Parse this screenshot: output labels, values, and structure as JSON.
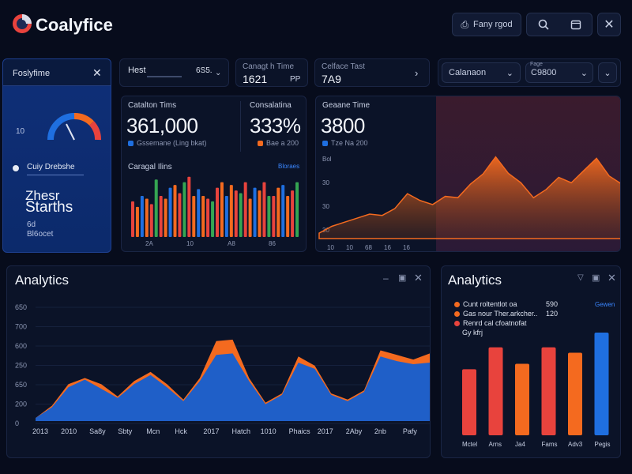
{
  "app": {
    "name": "Coalyfice"
  },
  "header": {
    "pill_label": "Fany rgod"
  },
  "side_card": {
    "title": "Foslyfime",
    "gauge_label": "10",
    "user_name": "Cuiy Drebshe",
    "big_text_1": "Zhesr",
    "big_text_2": "Starths",
    "foot_1": "6d",
    "foot_2": "Bl6ocet"
  },
  "stat_cards": [
    {
      "label": "Hest",
      "value": "6S5."
    },
    {
      "label": "Canagt h Time",
      "value": "1621",
      "suffix": "PP"
    },
    {
      "label": "Celface Tast",
      "value": "7A9"
    }
  ],
  "select": {
    "label": "Calanaon",
    "sub": "Fage",
    "value": "C9800"
  },
  "kpis": [
    {
      "title": "Catalton Tims",
      "value": "361,000",
      "legend": "Gssemane (Ling bkat)"
    },
    {
      "title": "Consalatina",
      "value": "333%",
      "legend": "Bae a 200"
    },
    {
      "title": "Geaane Time",
      "value": "3800",
      "legend": "Tze  Na 200"
    }
  ],
  "colors": {
    "orange": "#f46a1f",
    "blue": "#1f6fe0",
    "red": "#e8433d",
    "green": "#35a552",
    "panel": "#0b1328"
  },
  "small_bar_chart": {
    "title": "Caragal Ilins",
    "link": "Bloraes",
    "x_labels": [
      "2A",
      "10",
      "A8",
      "86"
    ]
  },
  "area_chart_small": {
    "x_labels": [
      "10",
      "10",
      "68",
      "16",
      "16"
    ],
    "y_labels": [
      "Bol",
      "30",
      "30",
      "30"
    ]
  },
  "analytics_main": {
    "title": "Analytics",
    "controls": [
      "minimize-icon",
      "restore-icon",
      "close-icon"
    ]
  },
  "analytics_side": {
    "title": "Analytics",
    "legend": [
      {
        "label": "Cunt roltentlot oa",
        "value": "590"
      },
      {
        "label": "Gas nour Ther.arkcher..",
        "value": "120"
      },
      {
        "label": "Renrd cal cfoatnofat",
        "value": ""
      }
    ],
    "legend_foot": "Gy kfrj",
    "link": "Gewen"
  },
  "chart_data": [
    {
      "type": "bar",
      "title": "Caragal Ilins",
      "categories": [
        "2A",
        "10",
        "A8",
        "86"
      ],
      "series": [
        {
          "values": [
            26,
            22,
            30,
            28,
            24,
            42,
            30,
            28,
            36,
            38,
            32,
            40,
            44,
            30,
            35,
            30,
            28,
            26,
            36,
            40,
            30,
            38,
            34,
            32,
            40,
            28,
            36,
            34,
            40,
            30,
            30,
            36,
            38,
            30,
            34,
            40
          ]
        }
      ]
    },
    {
      "type": "area",
      "x": [
        "10",
        "10",
        "68",
        "16",
        "16"
      ],
      "y_ticks": [
        "Bol",
        "30",
        "30",
        "30"
      ],
      "series": [
        {
          "values": [
            8,
            18,
            24,
            30,
            36,
            34,
            44,
            66,
            56,
            50,
            62,
            60,
            80,
            95,
            120,
            96,
            82,
            60,
            72,
            90,
            82,
            100,
            118,
            92,
            80
          ]
        }
      ]
    },
    {
      "type": "area",
      "title": "Analytics",
      "x": [
        "2013",
        "2010",
        "Sa8y",
        "Sbty",
        "Mcn",
        "Hck",
        "2017",
        "Hatch",
        "1010",
        "Phaics",
        "2017",
        "2Aby",
        "2nb",
        "Pafy"
      ],
      "y_ticks": [
        "650",
        "700",
        "600",
        "250",
        "650",
        "200",
        "0"
      ],
      "ylim": [
        0,
        750
      ],
      "series": [
        {
          "name": "orange",
          "values": [
            20,
            100,
            240,
            280,
            240,
            160,
            260,
            320,
            240,
            140,
            280,
            520,
            530,
            280,
            120,
            180,
            420,
            360,
            180,
            140,
            200,
            460,
            430,
            400,
            440
          ]
        },
        {
          "name": "blue",
          "values": [
            20,
            90,
            220,
            270,
            210,
            150,
            240,
            300,
            220,
            130,
            260,
            430,
            440,
            260,
            110,
            170,
            380,
            340,
            170,
            130,
            190,
            420,
            390,
            370,
            380
          ]
        }
      ]
    },
    {
      "type": "bar",
      "title": "Analytics",
      "categories": [
        "Mctel",
        "Arns",
        "Ja4",
        "Fams",
        "Adv3",
        "Pegis"
      ],
      "series": [
        {
          "values": [
            360,
            480,
            390,
            480,
            450,
            560
          ]
        }
      ]
    }
  ]
}
